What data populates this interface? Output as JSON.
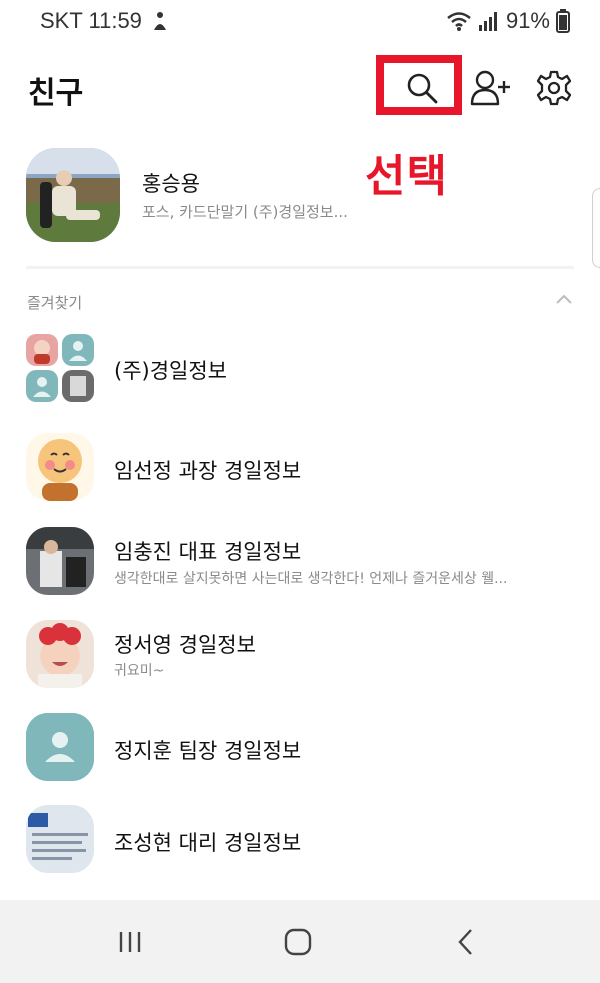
{
  "status_bar": {
    "carrier_time": "SKT 11:59",
    "battery": "91%"
  },
  "header": {
    "title": "친구",
    "search_icon": "search-icon",
    "add_friend_icon": "add-friend-icon",
    "settings_icon": "gear-icon"
  },
  "annotation": {
    "label": "선택",
    "color": "#e8162a"
  },
  "my_profile": {
    "name": "홍승용",
    "status": "포스, 카드단말기 (주)경일정보..."
  },
  "favorites": {
    "title": "즐겨찾기",
    "items": [
      {
        "name": "(주)경일정보",
        "status": ""
      },
      {
        "name": "임선정 과장 경일정보",
        "status": ""
      },
      {
        "name": "임충진 대표 경일정보",
        "status": "생각한대로 살지못하면 사는대로 생각한다! 언제나 즐거운세상 웰..."
      },
      {
        "name": "정서영 경일정보",
        "status": "귀요미~"
      },
      {
        "name": "정지훈 팀장 경일정보",
        "status": ""
      },
      {
        "name": "조성현 대리 경일정보",
        "status": ""
      }
    ]
  },
  "nav": {
    "recent_icon": "recent-apps-icon",
    "home_icon": "home-icon",
    "back_icon": "back-icon"
  }
}
